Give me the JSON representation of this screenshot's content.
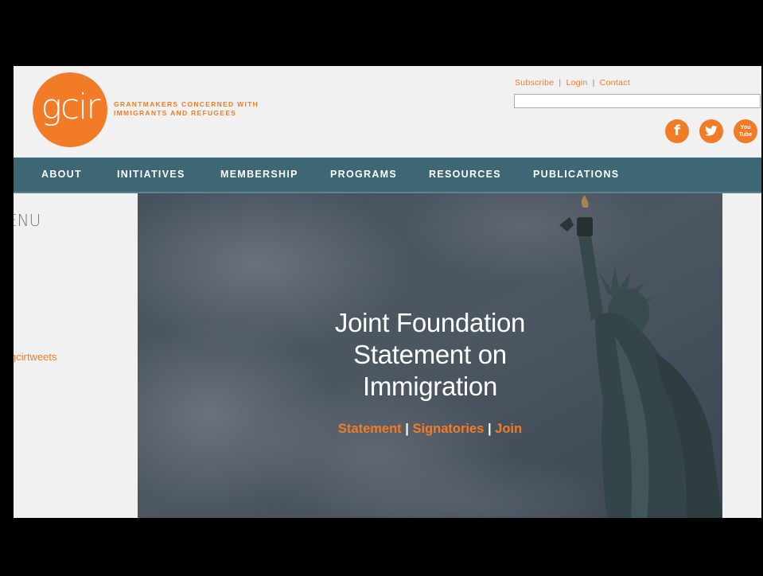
{
  "brand": {
    "logo_text": "gcir",
    "tagline_line1": "GRANTMAKERS CONCERNED WITH",
    "tagline_line2": "IMMIGRANTS AND REFUGEES",
    "accent_color": "#f27b28",
    "nav_color": "#3d6775"
  },
  "header": {
    "links": [
      "Subscribe",
      "Login",
      "Contact"
    ],
    "search_placeholder": "",
    "social": [
      {
        "icon": "facebook-icon",
        "glyph": "f"
      },
      {
        "icon": "twitter-icon",
        "glyph": "🐦"
      },
      {
        "icon": "youtube-icon",
        "glyph_line1": "You",
        "glyph_line2": "Tube"
      }
    ]
  },
  "nav": {
    "items": [
      "ABOUT",
      "INITIATIVES",
      "MEMBERSHIP",
      "PROGRAMS",
      "RESOURCES",
      "PUBLICATIONS"
    ]
  },
  "sidebar": {
    "menu_label": "ENU",
    "twitter_handle": "gcirtweets"
  },
  "hero": {
    "title_line1": "Joint Foundation",
    "title_line2": "Statement on",
    "title_line3": "Immigration",
    "links": [
      "Statement",
      "Signatories",
      "Join"
    ],
    "separator": "|"
  }
}
